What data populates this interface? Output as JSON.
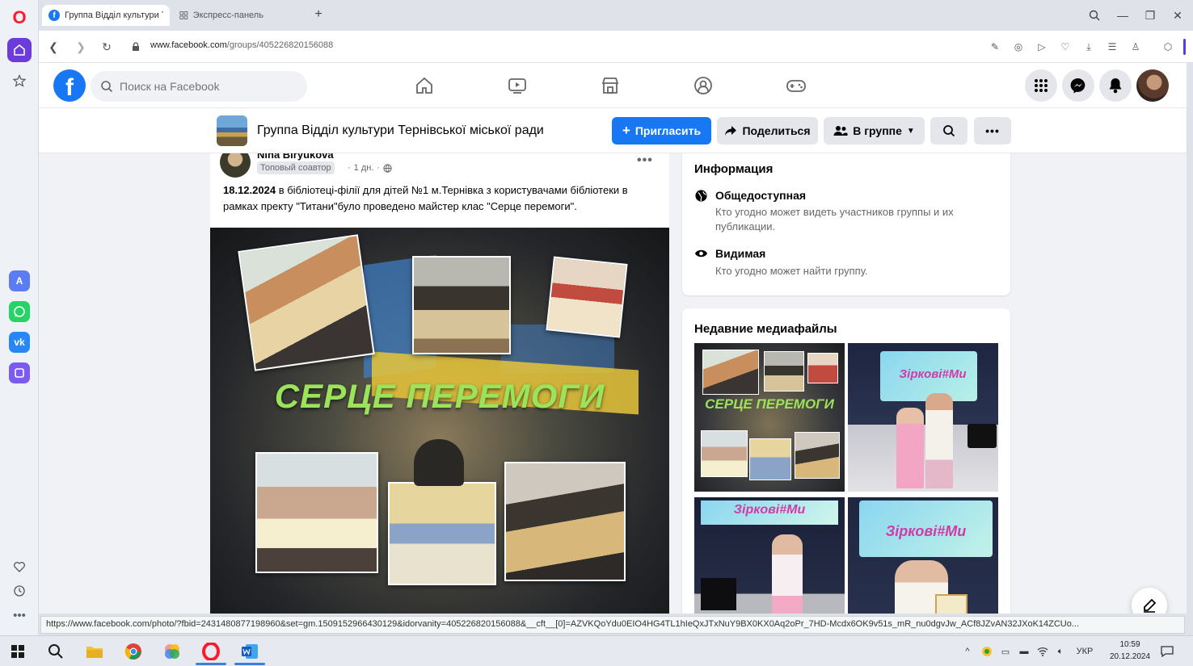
{
  "browser": {
    "tabs": [
      {
        "label": "Группа Відділ культури Те"
      },
      {
        "label": "Экспресс-панель"
      }
    ],
    "url_host": "www.facebook.com",
    "url_path": "/groups/405226820156088"
  },
  "facebook": {
    "search_placeholder": "Поиск на Facebook",
    "logo_letter": "f"
  },
  "group": {
    "name": "Группа Відділ культури Тернівської міської ради",
    "invite_label": "Пригласить",
    "share_label": "Поделиться",
    "membership_label": "В группе"
  },
  "post": {
    "author": "Nina Biryukova",
    "badge": "Топовый соавтор",
    "time": "1 дн.",
    "text_date": "18.12.2024",
    "text_body": " в бібліотеці-філії для дітей №1 м.Тернівка з користувачами бібліотеки в рамках пректу \"Титани\"було проведено майстер клас \"Серце перемоги\".",
    "poster_title": "СЕРЦЕ ПЕРЕМОГИ"
  },
  "info_card": {
    "title": "Информация",
    "public_title": "Общедоступная",
    "public_desc": "Кто угодно может видеть участников группы и их публикации.",
    "visible_title": "Видимая",
    "visible_desc": "Кто угодно может найти группу."
  },
  "media_card": {
    "title": "Недавние медиафайлы",
    "tile1_text": "СЕРЦЕ ПЕРЕМОГИ",
    "tile2_text": "Зіркові#Ми",
    "tile3_text": "Зіркові#Ми",
    "tile4_text": "Зіркові#Ми"
  },
  "status_url": "https://www.facebook.com/photo/?fbid=2431480877198960&set=gm.1509152966430129&idorvanity=405226820156088&__cft__[0]=AZVKQoYdu0EIO4HG4TL1hIeQxJTxNuY9BX0KX0Aq2oPr_7HD-Mcdx6OK9v51s_mR_nu0dgvJw_ACf8JZvAN32JXoK14ZCUo...",
  "taskbar": {
    "lang": "УКР",
    "time": "10:59",
    "date": "20.12.2024"
  },
  "colors": {
    "facebook_blue": "#1877f2",
    "opera_red": "#ff1b2d",
    "opera_purple": "#6c3bdb",
    "poster_green": "#9be35a"
  }
}
